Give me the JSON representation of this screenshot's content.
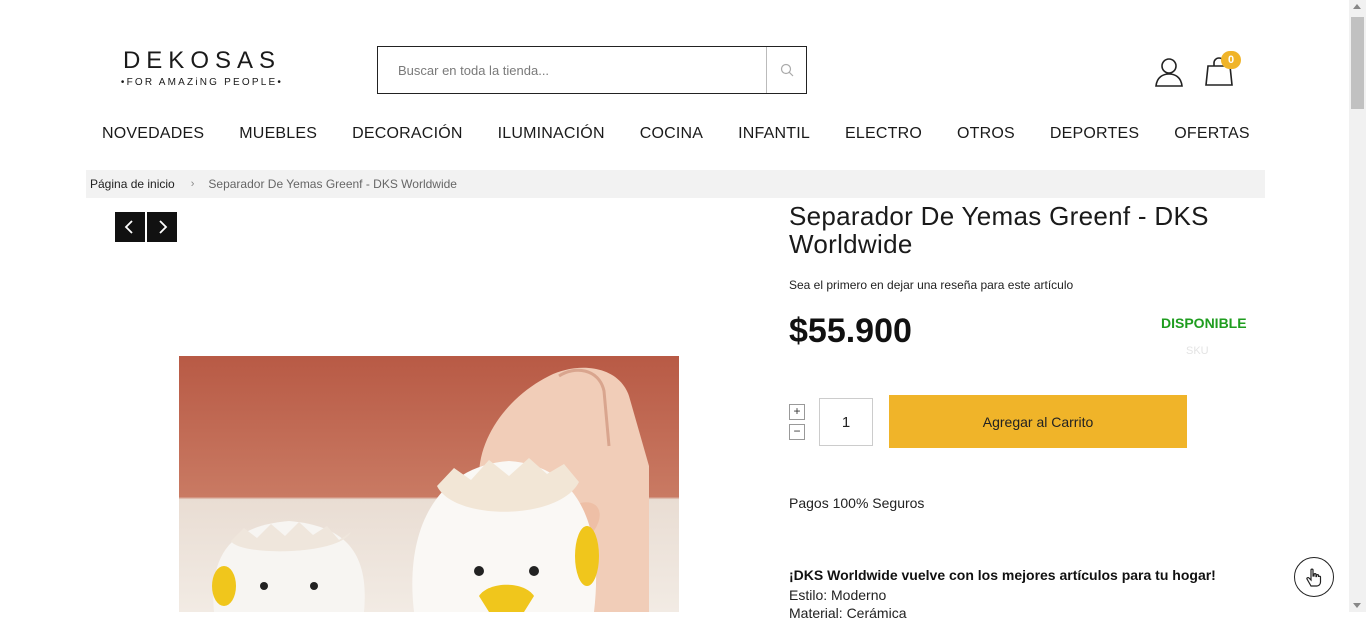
{
  "header": {
    "logo_main": "DEKOSAS",
    "logo_tagline": "•FOR AMAZiNG PEOPLE•",
    "search_placeholder": "Buscar en toda la tienda...",
    "cart_count": "0",
    "icons": {
      "search": "search-icon",
      "account": "user-icon",
      "cart": "shopping-bag-icon"
    }
  },
  "nav": {
    "items": [
      "NOVEDADES",
      "MUEBLES",
      "DECORACIÓN",
      "ILUMINACIÓN",
      "COCINA",
      "INFANTIL",
      "ELECTRO",
      "OTROS",
      "DEPORTES",
      "OFERTAS"
    ]
  },
  "breadcrumb": {
    "home": "Página de inicio",
    "separator": "›",
    "current": "Separador De Yemas Greenf - DKS Worldwide"
  },
  "product": {
    "title": "Separador De Yemas Greenf - DKS Worldwide",
    "review_text": "Sea el primero en dejar una reseña para este artículo",
    "price": "$55.900",
    "stock": "DISPONIBLE",
    "sku_label": "SKU",
    "quantity": "1",
    "add_to_cart": "Agregar al Carrito",
    "payments": "Pagos 100% Seguros",
    "description": {
      "heading": "¡DKS Worldwide vuelve con los mejores artículos para tu hogar!",
      "style": "Estilo: Moderno",
      "material": "Material: Cerámica"
    }
  },
  "colors": {
    "accent": "#f0b429",
    "stock_green": "#1f9d1f",
    "breadcrumb_bg": "#f2f2f2"
  }
}
